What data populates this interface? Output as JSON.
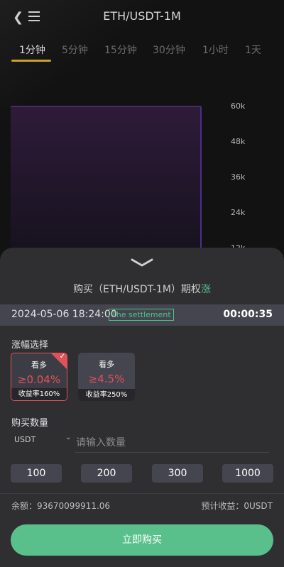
{
  "header": {
    "title": "ETH/USDT-1M"
  },
  "tabs": [
    "1分钟",
    "5分钟",
    "15分钟",
    "30分钟",
    "1小时",
    "1天"
  ],
  "chart_data": {
    "type": "area",
    "y_ticks": [
      "60k",
      "48k",
      "36k",
      "24k",
      "12k"
    ],
    "ylim": [
      0,
      72000
    ],
    "values": [
      60000
    ],
    "fill_color": "#2e1b3a"
  },
  "buy": {
    "title_prefix": "购买（ETH/USDT-1M）期权",
    "title_direction": "涨"
  },
  "timebar": {
    "datetime": "2024-05-06 18:24:00",
    "settlement": "The settlement",
    "countdown": "00:00:35"
  },
  "amplitude": {
    "label": "涨幅选择",
    "options": [
      {
        "head": "看多",
        "pct": "≥0.04%",
        "yield": "收益率160%",
        "selected": true
      },
      {
        "head": "看多",
        "pct": "≥4.5%",
        "yield": "收益率250%",
        "selected": false
      }
    ]
  },
  "quantity": {
    "label": "购买数量",
    "unit": "USDT",
    "placeholder": "请输入数量",
    "presets": [
      "100",
      "200",
      "300",
      "1000"
    ]
  },
  "footer": {
    "balance": "余额：93670099911.06",
    "expected": "预计收益：0USDT",
    "buy_button": "立即购买"
  },
  "colors": {
    "accent_green": "#5ac08b",
    "accent_red": "#e0525a",
    "tab_underline": "#c9a227"
  }
}
